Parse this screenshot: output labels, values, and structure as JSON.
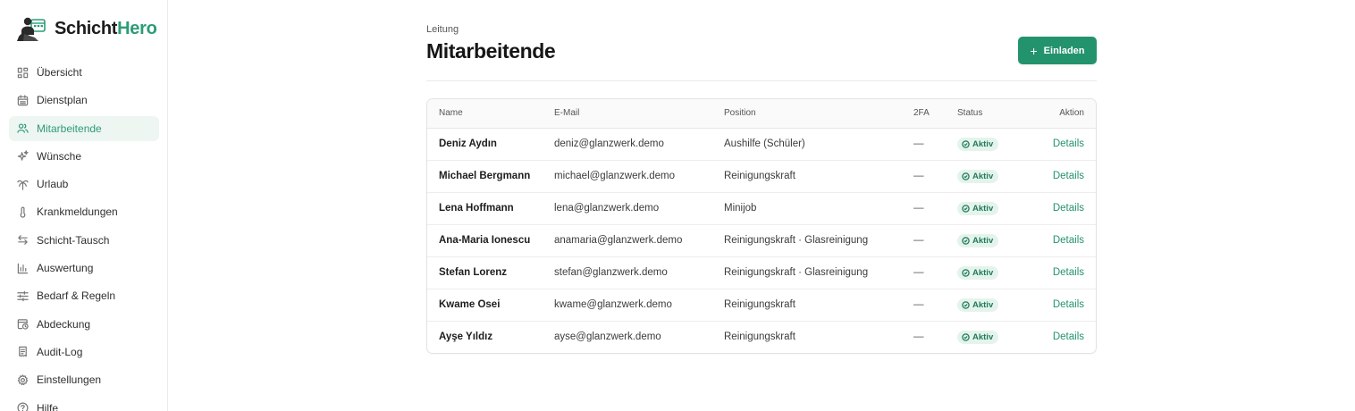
{
  "brand": {
    "name_part1": "Schicht",
    "name_part2": "Hero",
    "accent": "#2c9c77"
  },
  "sidebar": {
    "items": [
      {
        "label": "Übersicht",
        "icon": "grid-icon",
        "active": false
      },
      {
        "label": "Dienstplan",
        "icon": "calendar-icon",
        "active": false
      },
      {
        "label": "Mitarbeitende",
        "icon": "users-icon",
        "active": true
      },
      {
        "label": "Wünsche",
        "icon": "sparkles-icon",
        "active": false
      },
      {
        "label": "Urlaub",
        "icon": "palm-tree-icon",
        "active": false
      },
      {
        "label": "Krankmeldungen",
        "icon": "thermometer-icon",
        "active": false
      },
      {
        "label": "Schicht-Tausch",
        "icon": "swap-icon",
        "active": false
      },
      {
        "label": "Auswertung",
        "icon": "bar-chart-icon",
        "active": false
      },
      {
        "label": "Bedarf & Regeln",
        "icon": "sliders-icon",
        "active": false
      },
      {
        "label": "Abdeckung",
        "icon": "calendar-clock-icon",
        "active": false
      },
      {
        "label": "Audit-Log",
        "icon": "receipt-icon",
        "active": false
      },
      {
        "label": "Einstellungen",
        "icon": "gear-icon",
        "active": false
      },
      {
        "label": "Hilfe",
        "icon": "help-circle-icon",
        "active": false
      }
    ]
  },
  "header": {
    "breadcrumb": "Leitung",
    "title": "Mitarbeitende",
    "invite_label": "Einladen"
  },
  "table": {
    "columns": {
      "name": "Name",
      "email": "E-Mail",
      "position": "Position",
      "twofa": "2FA",
      "status": "Status",
      "action": "Aktion"
    },
    "rows": [
      {
        "name": "Deniz Aydın",
        "email": "deniz@glanzwerk.demo",
        "position": "Aushilfe (Schüler)",
        "twofa": "—",
        "status": "Aktiv",
        "action": "Details"
      },
      {
        "name": "Michael Bergmann",
        "email": "michael@glanzwerk.demo",
        "position": "Reinigungskraft",
        "twofa": "—",
        "status": "Aktiv",
        "action": "Details"
      },
      {
        "name": "Lena Hoffmann",
        "email": "lena@glanzwerk.demo",
        "position": "Minijob",
        "twofa": "—",
        "status": "Aktiv",
        "action": "Details"
      },
      {
        "name": "Ana-Maria Ionescu",
        "email": "anamaria@glanzwerk.demo",
        "position": "Reinigungskraft · Glasreinigung",
        "twofa": "—",
        "status": "Aktiv",
        "action": "Details"
      },
      {
        "name": "Stefan Lorenz",
        "email": "stefan@glanzwerk.demo",
        "position": "Reinigungskraft · Glasreinigung",
        "twofa": "—",
        "status": "Aktiv",
        "action": "Details"
      },
      {
        "name": "Kwame Osei",
        "email": "kwame@glanzwerk.demo",
        "position": "Reinigungskraft",
        "twofa": "—",
        "status": "Aktiv",
        "action": "Details"
      },
      {
        "name": "Ayşe Yıldız",
        "email": "ayse@glanzwerk.demo",
        "position": "Reinigungskraft",
        "twofa": "—",
        "status": "Aktiv",
        "action": "Details"
      }
    ]
  },
  "colors": {
    "primary": "#23936e",
    "badge_bg": "#e4f4ec",
    "badge_text": "#207a5b",
    "active_nav_bg": "#eef6f2"
  }
}
